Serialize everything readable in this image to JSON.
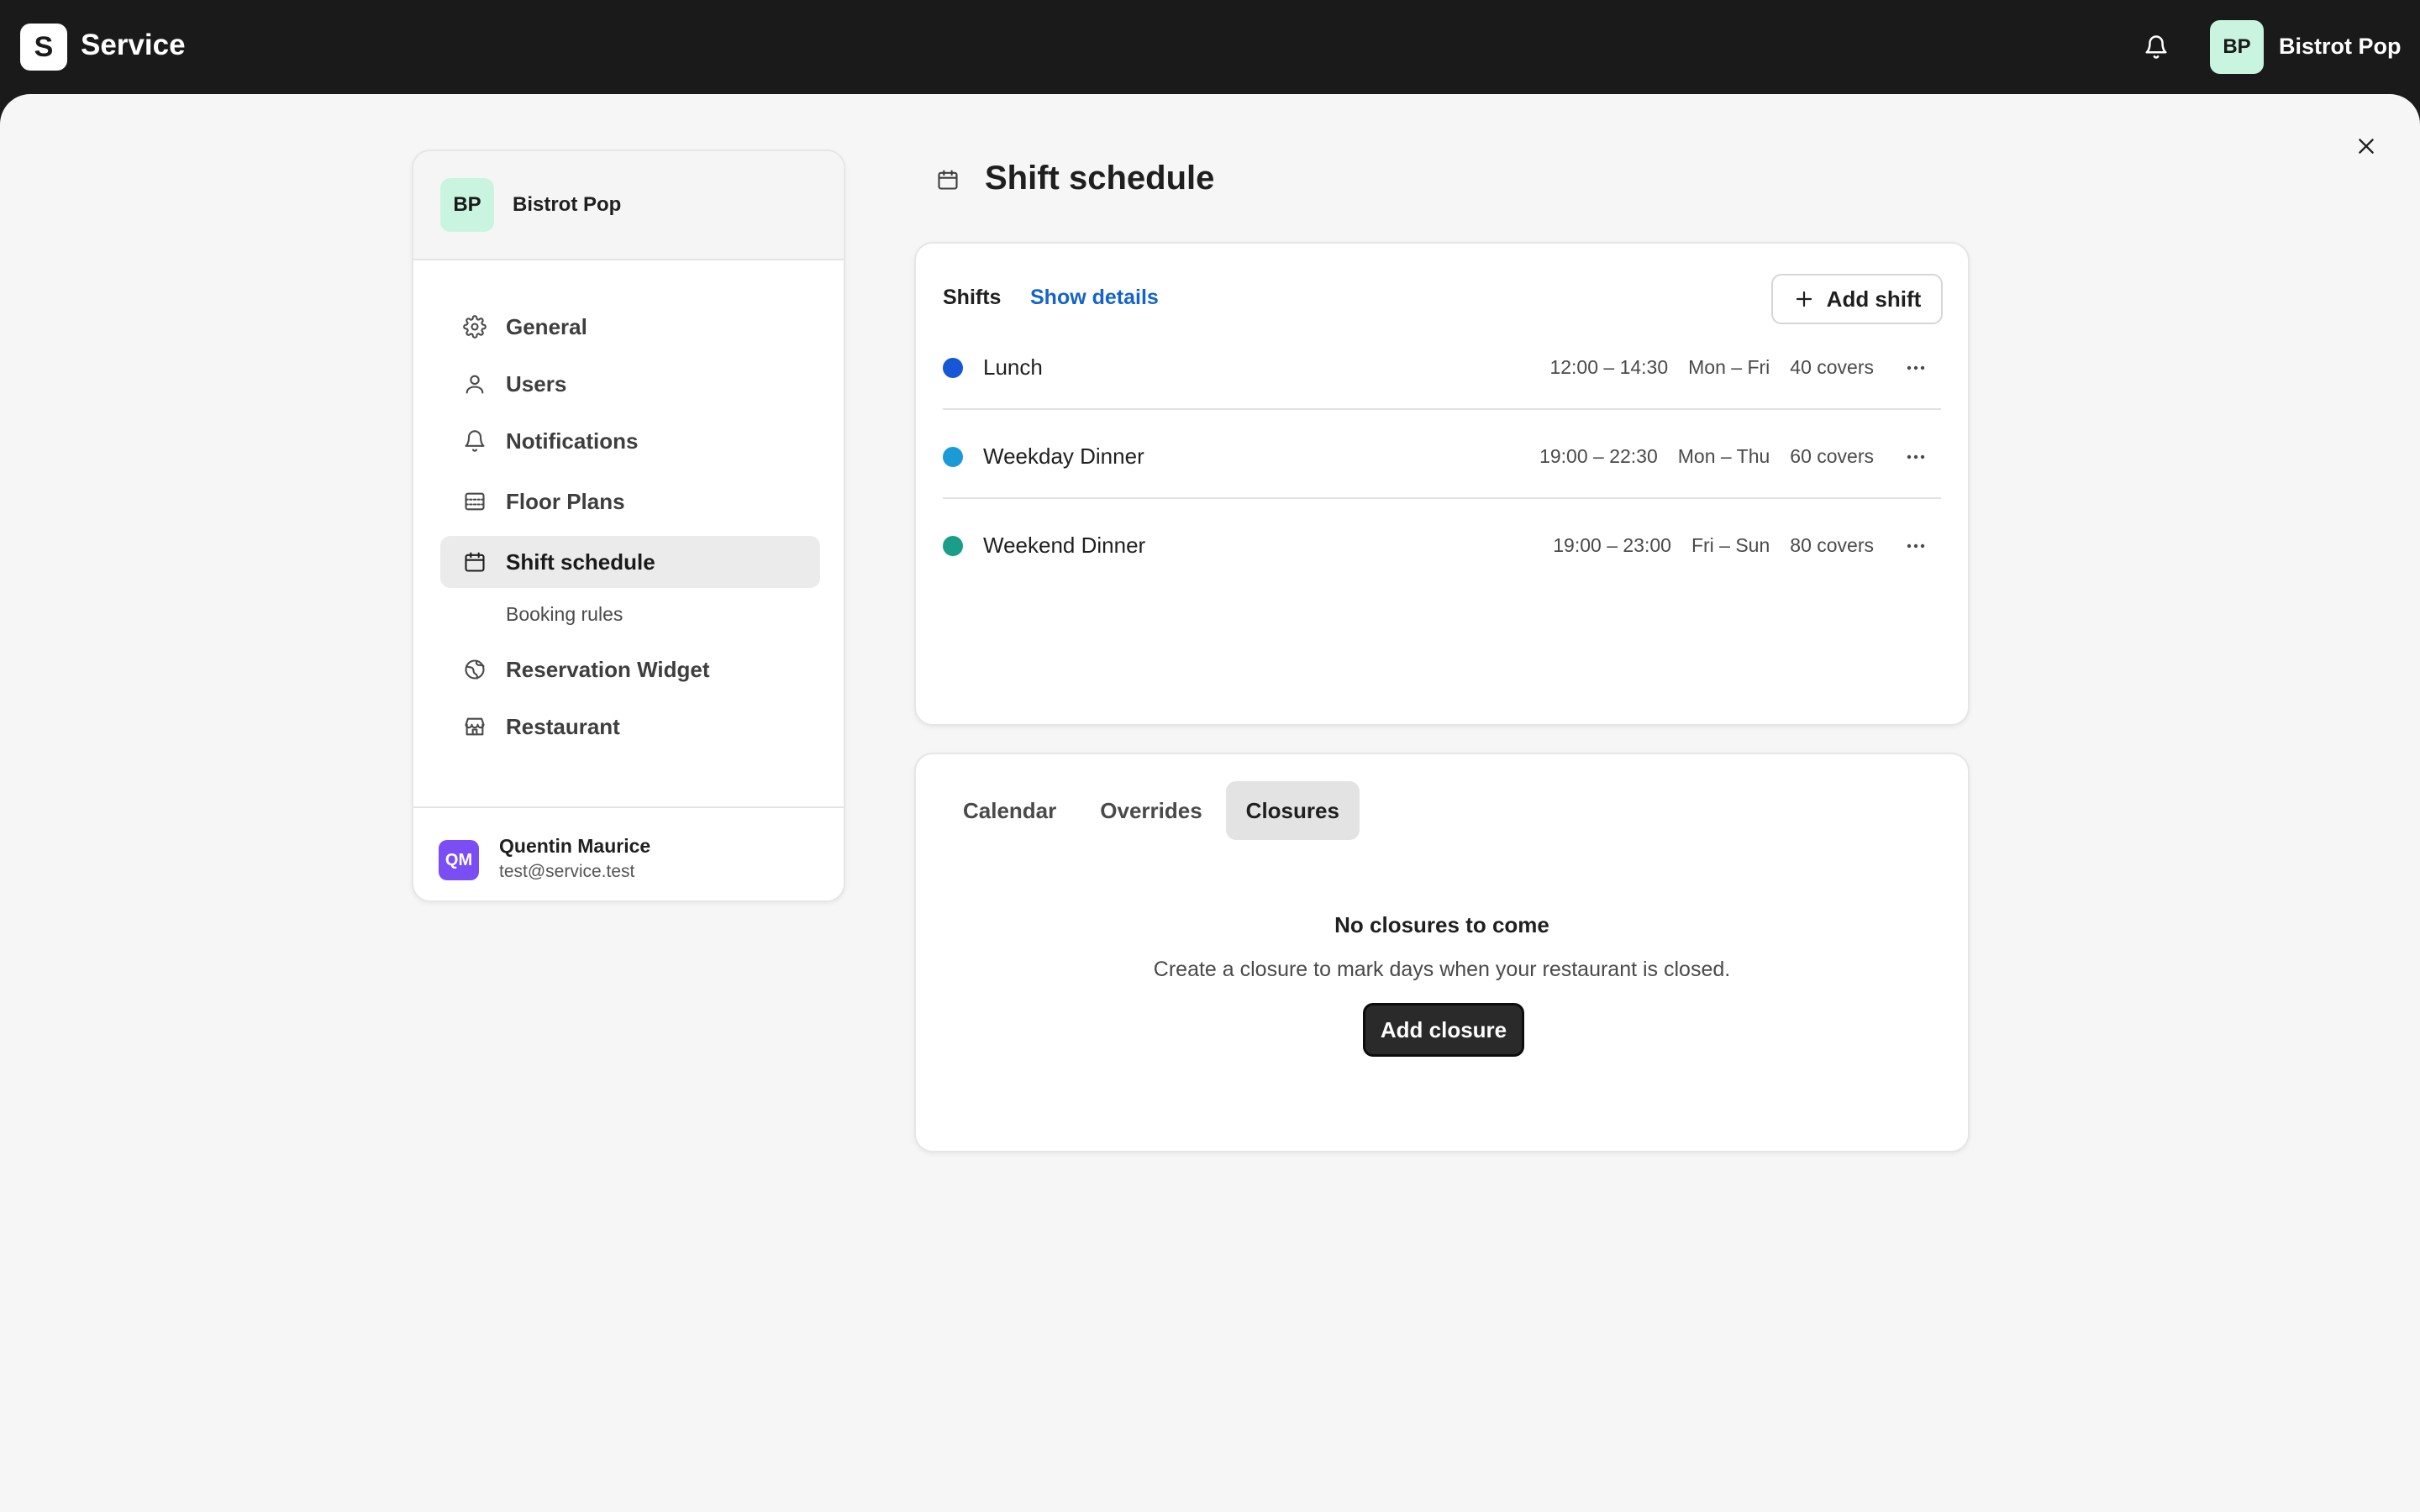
{
  "topbar": {
    "logo_letter": "S",
    "app_name": "Service",
    "avatar_initials": "BP",
    "user_name": "Bistrot Pop"
  },
  "sidebar": {
    "header": {
      "avatar_initials": "BP",
      "title": "Bistrot Pop"
    },
    "items": [
      {
        "label": "General",
        "icon": "gear-icon"
      },
      {
        "label": "Users",
        "icon": "user-icon"
      },
      {
        "label": "Notifications",
        "icon": "bell-icon"
      },
      {
        "label": "Floor Plans",
        "icon": "floor-plan-icon"
      },
      {
        "label": "Shift schedule",
        "icon": "calendar-icon",
        "active": true
      },
      {
        "label": "Booking rules",
        "sub": true
      },
      {
        "label": "Reservation Widget",
        "icon": "globe-icon"
      },
      {
        "label": "Restaurant",
        "icon": "store-icon"
      }
    ],
    "footer": {
      "avatar_initials": "QM",
      "name": "Quentin Maurice",
      "email": "test@service.test"
    }
  },
  "main": {
    "title": "Shift schedule",
    "shifts": {
      "label": "Shifts",
      "show_details": "Show details",
      "add_shift": "Add shift",
      "rows": [
        {
          "name": "Lunch",
          "time": "12:00 – 14:30",
          "days": "Mon – Fri",
          "covers": "40 covers",
          "color": "#1557d4"
        },
        {
          "name": "Weekday Dinner",
          "time": "19:00 – 22:30",
          "days": "Mon – Thu",
          "covers": "60 covers",
          "color": "#1a9ad6"
        },
        {
          "name": "Weekend Dinner",
          "time": "19:00 – 23:00",
          "days": "Fri – Sun",
          "covers": "80 covers",
          "color": "#1a9e8a"
        }
      ]
    },
    "closures": {
      "tabs": [
        {
          "label": "Calendar"
        },
        {
          "label": "Overrides"
        },
        {
          "label": "Closures",
          "active": true
        }
      ],
      "empty_title": "No closures to come",
      "empty_desc": "Create a closure to mark days when your restaurant is closed.",
      "add_button": "Add closure"
    }
  }
}
